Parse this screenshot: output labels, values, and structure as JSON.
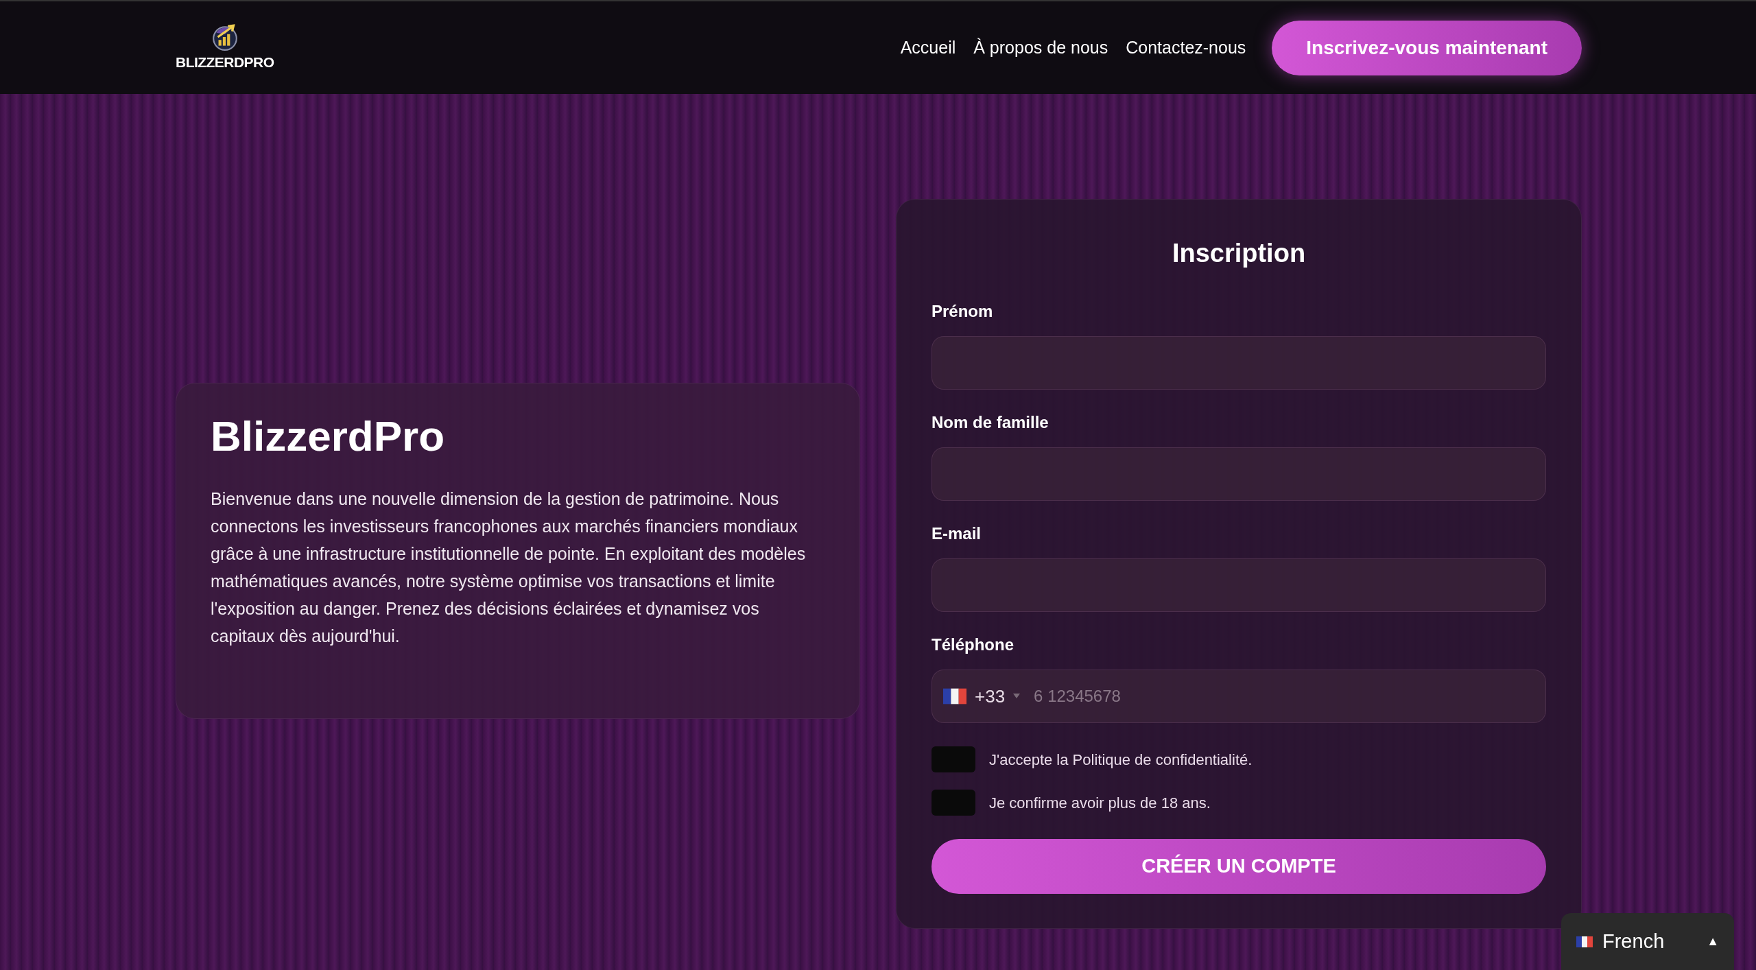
{
  "header": {
    "logo_text": "BLIZZERDPRO",
    "nav": [
      {
        "label": "Accueil"
      },
      {
        "label": "À propos de nous"
      },
      {
        "label": "Contactez-nous"
      }
    ],
    "cta": "Inscrivez-vous maintenant"
  },
  "intro": {
    "title": "BlizzerdPro",
    "text": "Bienvenue dans une nouvelle dimension de la gestion de patrimoine. Nous connectons les investisseurs francophones aux marchés financiers mondiaux grâce à une infrastructure institutionnelle de pointe. En exploitant des modèles mathématiques avancés, notre système optimise vos transactions et limite l'exposition au danger. Prenez des décisions éclairées et dynamisez vos capitaux dès aujourd'hui."
  },
  "form": {
    "title": "Inscription",
    "fields": [
      {
        "kind": "text",
        "label": "Prénom"
      },
      {
        "kind": "text",
        "label": "Nom de famille"
      },
      {
        "kind": "text",
        "label": "E-mail"
      },
      {
        "kind": "phone",
        "label": "Téléphone",
        "dial_code": "+33",
        "placeholder": "6 12345678"
      }
    ],
    "checkboxes": [
      {
        "label": "J'accepte la Politique de confidentialité.",
        "checked": false
      },
      {
        "label": "Je confirme avoir plus de 18 ans.",
        "checked": false
      }
    ],
    "submit": "CRÉER UN COMPTE"
  },
  "language": {
    "label": "French",
    "caret": "▲"
  }
}
